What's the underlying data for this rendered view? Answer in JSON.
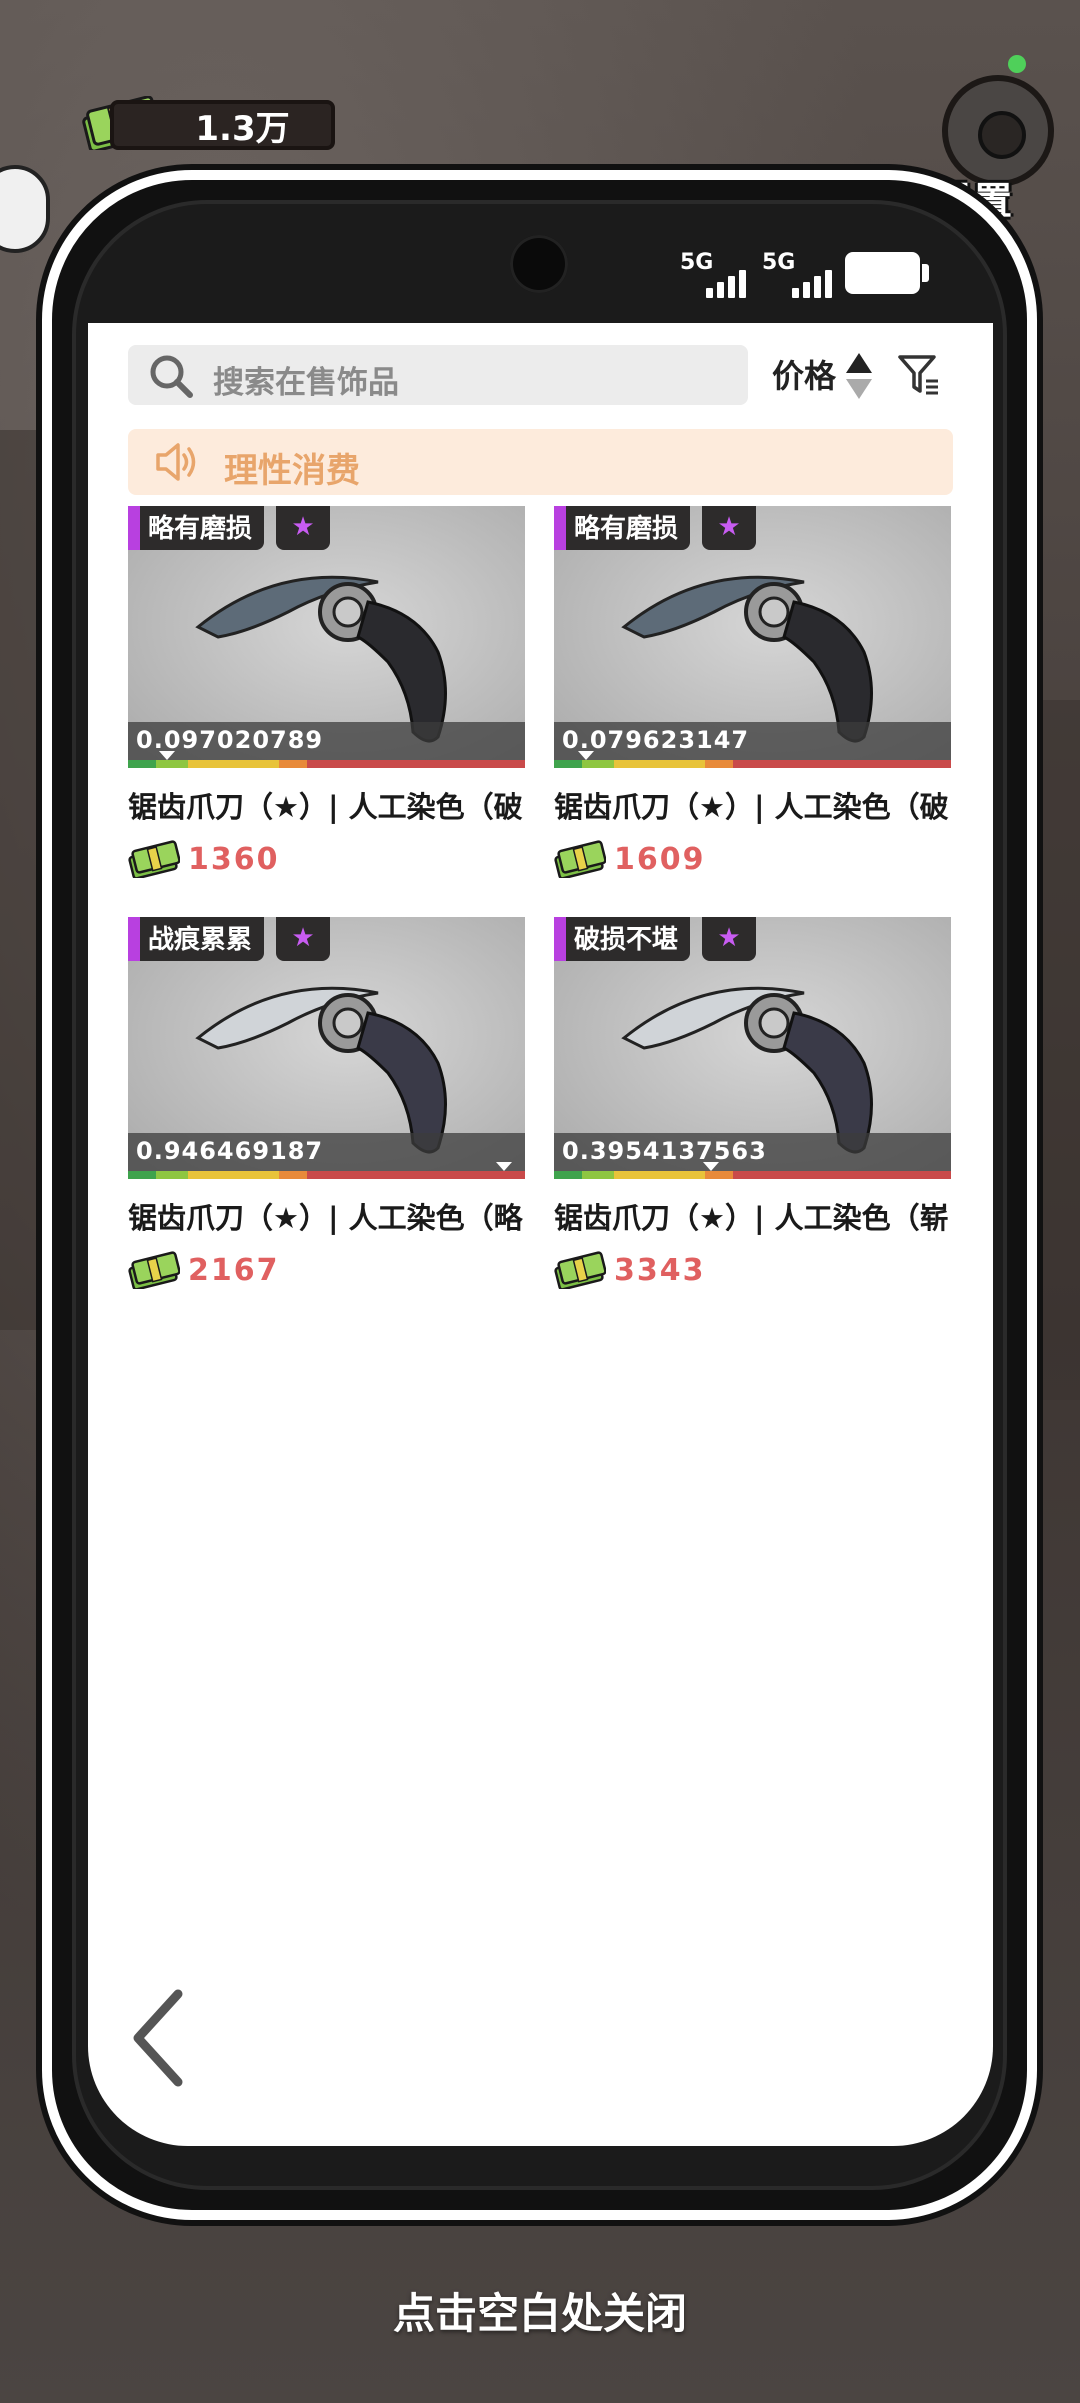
{
  "hud": {
    "money": "1.3万",
    "settings_label": "设置"
  },
  "status_bar": {
    "sim1": "5G",
    "sim2": "5G"
  },
  "market": {
    "search_placeholder": "搜索在售饰品",
    "sort_label": "价格",
    "notice_text": "理性消费",
    "items": [
      {
        "wear_label": "略有磨损",
        "star": "★",
        "float_value": "0.097020789",
        "float_fraction": 0.097020789,
        "name": "锯齿爪刀（★）| 人工染色（破",
        "price": "1360",
        "style": "dark"
      },
      {
        "wear_label": "略有磨损",
        "star": "★",
        "float_value": "0.079623147",
        "float_fraction": 0.079623147,
        "name": "锯齿爪刀（★）| 人工染色（破",
        "price": "1609",
        "style": "dark"
      },
      {
        "wear_label": "战痕累累",
        "star": "★",
        "float_value": "0.946469187",
        "float_fraction": 0.946469187,
        "name": "锯齿爪刀（★）| 人工染色（略",
        "price": "2167",
        "style": "light"
      },
      {
        "wear_label": "破损不堪",
        "star": "★",
        "float_value": "0.3954137563",
        "float_fraction": 0.3954137563,
        "name": "锯齿爪刀（★）| 人工染色（崭",
        "price": "3343",
        "style": "light"
      }
    ]
  },
  "footer": {
    "close_hint": "点击空白处关闭"
  },
  "colors": {
    "price": "#e06060",
    "notice_text": "#e8a56b",
    "notice_bg": "#fdebdc",
    "wear_accent": "#b840e0",
    "star": "#c85cf2"
  },
  "icons": [
    "money-icon",
    "gear-icon",
    "search-icon",
    "sort-arrows-icon",
    "filter-icon",
    "speaker-icon",
    "cash-icon",
    "back-chevron-icon"
  ]
}
